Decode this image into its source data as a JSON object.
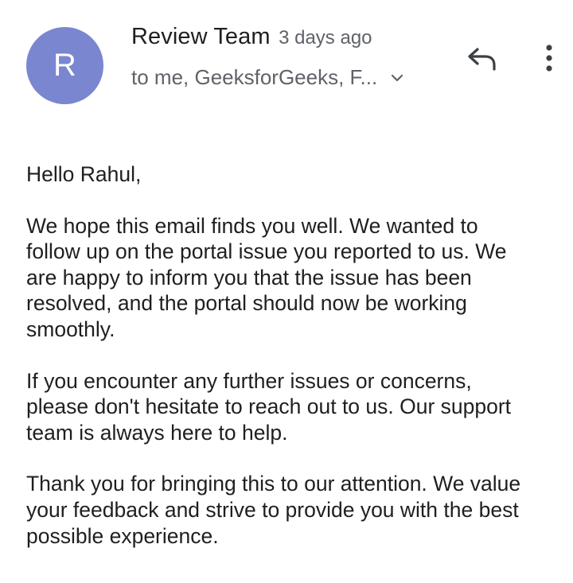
{
  "header": {
    "avatar_letter": "R",
    "sender_name": "Review Team",
    "time": "3 days ago",
    "recipients": "to me, GeeksforGeeks, F...",
    "icons": {
      "reply": "reply-icon",
      "more": "more-vert-icon",
      "expand": "chevron-down-icon"
    },
    "colors": {
      "avatar": "#7b86d1"
    }
  },
  "body": {
    "greeting": "Hello Rahul,",
    "paragraphs": [
      "We hope this email finds you well. We wanted to\nfollow up on the portal issue you reported to us. We\nare happy to inform you that the issue has been\nresolved, and the portal should now be working\nsmoothly.",
      "If you encounter any further issues or concerns,\nplease don't hesitate to reach out to us. Our support\nteam is always here to help.",
      "Thank you for bringing this to our attention. We value\nyour feedback and strive to provide you with the best\npossible experience."
    ]
  }
}
